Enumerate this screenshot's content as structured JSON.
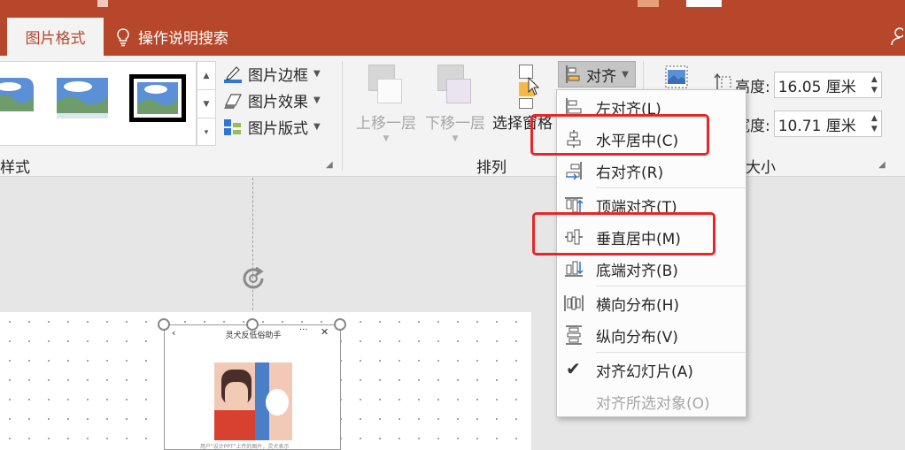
{
  "ribbon_tabs": {
    "active": "图片格式",
    "tell_me": "操作说明搜索"
  },
  "picture_styles": {
    "group_label": "样式",
    "border": "图片边框",
    "effects": "图片效果",
    "layout": "图片版式"
  },
  "arrange": {
    "group_label": "排列",
    "bring_forward": "上移一层",
    "send_backward": "下移一层",
    "selection_pane": "选择窗格",
    "align": "对齐"
  },
  "size": {
    "group_label": "大小",
    "height_label": "高度:",
    "height_value": "16.05 厘米",
    "width_label": "宽度:",
    "width_value": "10.71 厘米"
  },
  "align_menu": {
    "items": [
      "左对齐(L)",
      "水平居中(C)",
      "右对齐(R)",
      "顶端对齐(T)",
      "垂直居中(M)",
      "底端对齐(B)",
      "横向分布(H)",
      "纵向分布(V)",
      "对齐幻灯片(A)",
      "对齐所选对象(O)"
    ]
  },
  "slide_image": {
    "title": "灵犬反低俗助手",
    "caption": "用户\"设计PPT\"上传的图片，灵犬表示"
  },
  "colors": {
    "accent": "#b7472a",
    "highlight_box": "#e8262a"
  }
}
